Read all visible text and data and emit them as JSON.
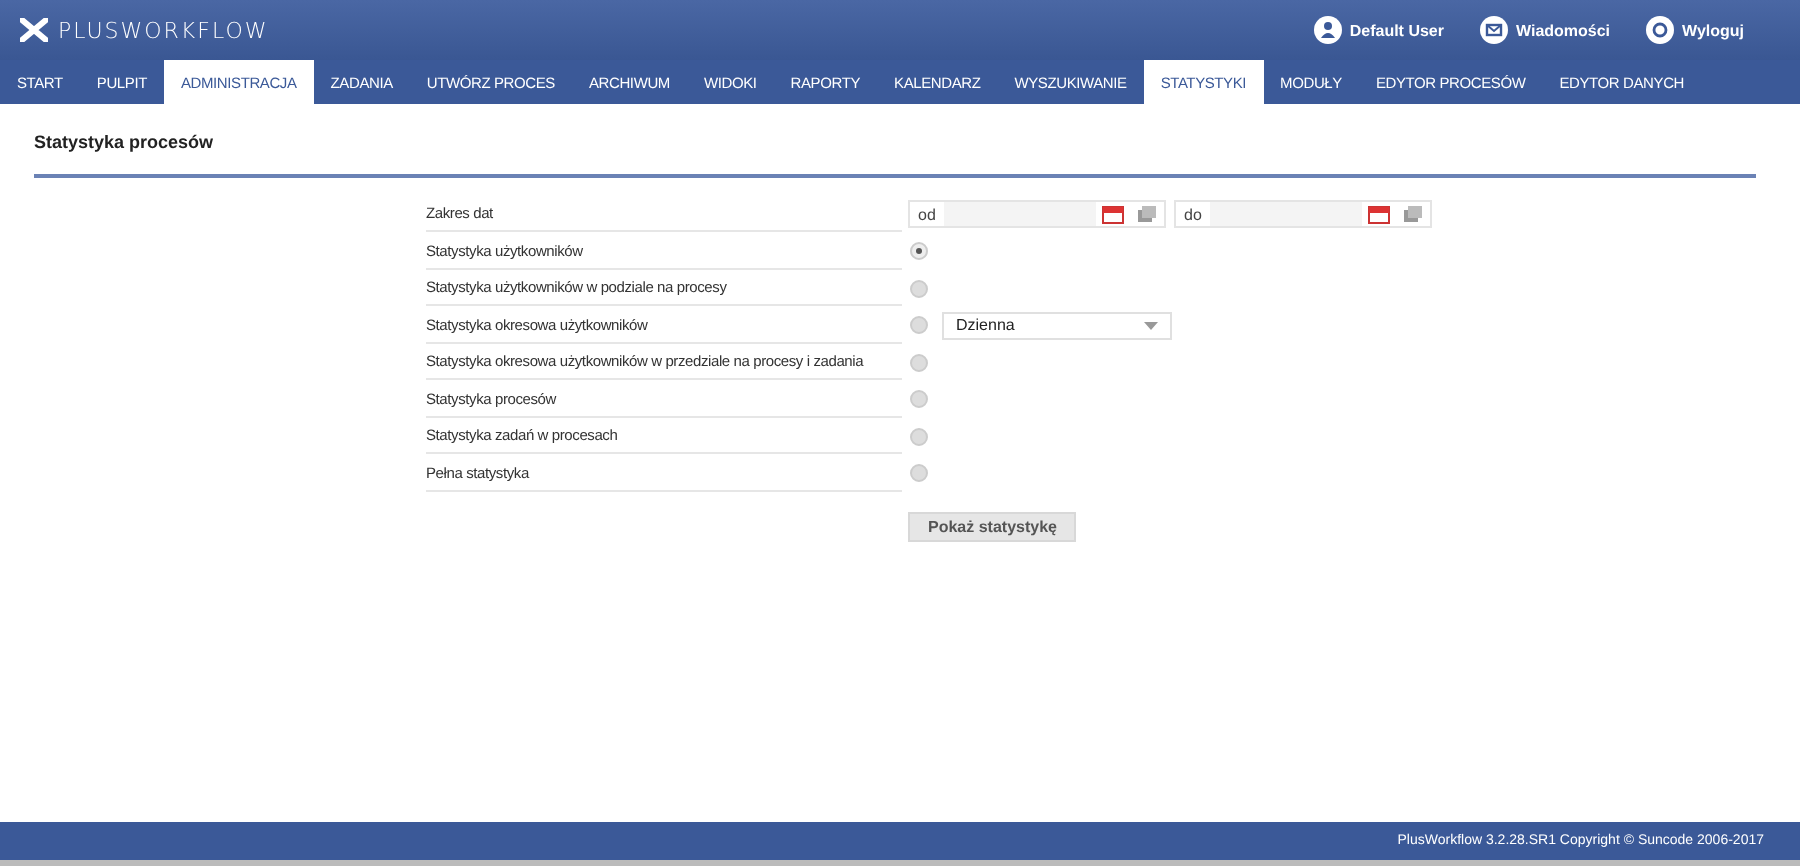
{
  "header": {
    "logo": "PLUSWORKFLOW",
    "user_links": [
      {
        "kind": "user",
        "label": "Default User"
      },
      {
        "kind": "messages",
        "label": "Wiadomości"
      },
      {
        "kind": "logout",
        "label": "Wyloguj"
      }
    ]
  },
  "nav": [
    {
      "label": "START",
      "selected": false
    },
    {
      "label": "PULPIT",
      "selected": false
    },
    {
      "label": "ADMINISTRACJA",
      "selected": true
    },
    {
      "label": "ZADANIA",
      "selected": false
    },
    {
      "label": "UTWÓRZ PROCES",
      "selected": false
    },
    {
      "label": "ARCHIWUM",
      "selected": false
    },
    {
      "label": "WIDOKI",
      "selected": false
    },
    {
      "label": "RAPORTY",
      "selected": false
    },
    {
      "label": "KALENDARZ",
      "selected": false
    },
    {
      "label": "WYSZUKIWANIE",
      "selected": false
    },
    {
      "label": "STATYSTYKI",
      "selected": true
    },
    {
      "label": "MODUŁY",
      "selected": false
    },
    {
      "label": "EDYTOR PROCESÓW",
      "selected": false
    },
    {
      "label": "EDYTOR DANYCH",
      "selected": false
    }
  ],
  "page_title": "Statystyka procesów",
  "date_range": {
    "label": "Zakres dat",
    "from_label": "od",
    "to_label": "do"
  },
  "options": [
    {
      "label": "Statystyka użytkowników",
      "selected": true
    },
    {
      "label": "Statystyka użytkowników w podziale na procesy",
      "selected": false
    },
    {
      "label": "Statystyka okresowa użytkowników",
      "selected": false,
      "select": {
        "value": "Dzienna"
      }
    },
    {
      "label": "Statystyka okresowa użytkowników w przedziale na procesy i zadania",
      "selected": false
    },
    {
      "label": "Statystyka procesów",
      "selected": false
    },
    {
      "label": "Statystyka zadań w procesach",
      "selected": false
    },
    {
      "label": "Pełna statystyka",
      "selected": false
    }
  ],
  "submit_button": "Pokaż statystykę",
  "footer": "PlusWorkflow 3.2.28.SR1 Copyright © Suncode 2006-2017"
}
